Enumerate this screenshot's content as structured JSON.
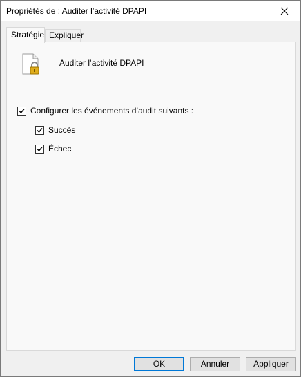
{
  "window": {
    "title": "Propriétés de : Auditer l’activité DPAPI"
  },
  "tabs": [
    {
      "label": "Stratégie",
      "active": true
    },
    {
      "label": "Expliquer",
      "active": false
    }
  ],
  "policy": {
    "name": "Auditer l’activité DPAPI",
    "icon": "document-lock-icon"
  },
  "options": {
    "configure": {
      "label": "Configurer les événements d’audit suivants :",
      "checked": true
    },
    "success": {
      "label": "Succès",
      "checked": true
    },
    "failure": {
      "label": "Échec",
      "checked": true
    }
  },
  "buttons": {
    "ok": "OK",
    "cancel": "Annuler",
    "apply": "Appliquer"
  },
  "colors": {
    "accent": "#0078d7",
    "lock": "#d9a400"
  }
}
